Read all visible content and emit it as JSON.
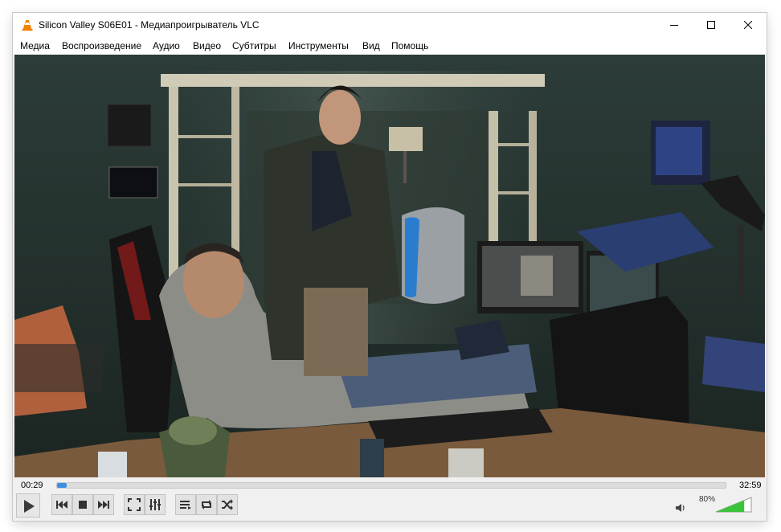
{
  "window": {
    "title": "Silicon Valley S06E01 - Медиапроигрыватель VLC",
    "icons": {
      "app": "vlc-cone-icon",
      "minimize": "minimize-icon",
      "maximize": "maximize-icon",
      "close": "close-icon"
    }
  },
  "menu": {
    "items": [
      "Медиа",
      "Воспроизведение",
      "Аудио",
      "Видео",
      "Субтитры",
      "Инструменты",
      "Вид",
      "Помощь"
    ]
  },
  "video": {
    "content": "video-frame-image"
  },
  "playback": {
    "elapsed": "00:29",
    "total": "32:59",
    "progress_fraction": 0.0147
  },
  "controls": {
    "buttons": [
      "play-icon",
      "previous-icon",
      "stop-icon",
      "next-icon",
      "fullscreen-icon",
      "extended-settings-icon",
      "playlist-icon",
      "loop-icon",
      "shuffle-icon"
    ]
  },
  "volume": {
    "label": "80%",
    "level_fraction": 0.8,
    "icon": "speaker-icon"
  },
  "colors": {
    "accent": "#3b8ee0",
    "volume_fill": "#3cc33c",
    "vlc_orange": "#f08300"
  }
}
